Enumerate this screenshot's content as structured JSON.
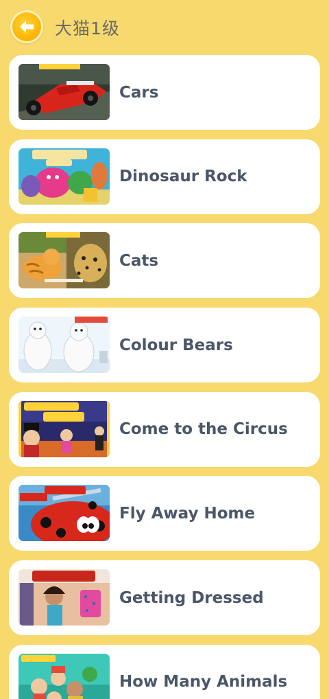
{
  "header": {
    "title": "大猫1级",
    "back_icon": "arrow-left-icon",
    "accent": "#ffb300"
  },
  "books": [
    {
      "title": "Cars",
      "cover_text": "Cars"
    },
    {
      "title": "Dinosaur Rock",
      "cover_text": "Dinosaur Rock"
    },
    {
      "title": "Cats",
      "cover_text": "Cats",
      "cover_subtext": "Claire Llewellyn"
    },
    {
      "title": "Colour Bears",
      "cover_text": "Bears"
    },
    {
      "title": "Come to the Circus",
      "cover_text": "Come to the Circus"
    },
    {
      "title": "Fly Away Home",
      "cover_text": "Fly Home"
    },
    {
      "title": "Getting Dressed",
      "cover_text": "Dressed"
    },
    {
      "title": "How Many Animals",
      "cover_text": "How"
    }
  ],
  "colors": {
    "background": "#f7d96e",
    "card": "#ffffff",
    "title_text": "#4a5768"
  }
}
